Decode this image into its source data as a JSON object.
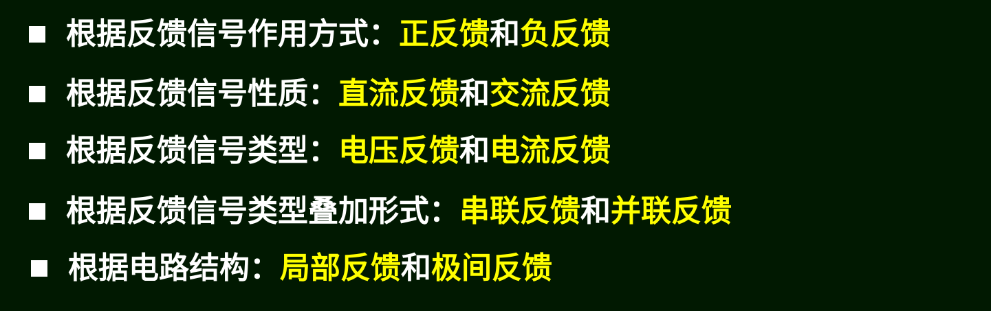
{
  "colors": {
    "background": "#011901",
    "text": "#ffffff",
    "highlight": "#ffff00"
  },
  "items": [
    {
      "bullet": "square",
      "label": "根据反馈信号作用方式：",
      "a": "正反馈",
      "joiner": "和",
      "b": "负反馈"
    },
    {
      "bullet": "square",
      "label": "根据反馈信号性质：",
      "a": "直流反馈",
      "joiner": "和",
      "b": "交流反馈"
    },
    {
      "bullet": "square",
      "label": "根据反馈信号类型：",
      "a": "电压反馈",
      "joiner": "和",
      "b": "电流反馈"
    },
    {
      "bullet": "square",
      "label": "根据反馈信号类型叠加形式：",
      "a": "串联反馈",
      "joiner": "和",
      "b": "并联反馈"
    },
    {
      "bullet": "square",
      "label": "根据电路结构：",
      "a": "局部反馈",
      "joiner": "和",
      "b": "极间反馈"
    }
  ]
}
